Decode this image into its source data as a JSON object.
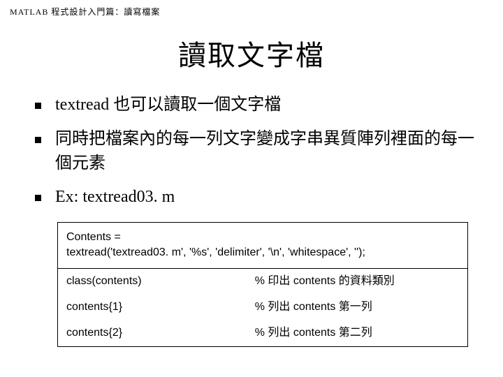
{
  "header": "MATLAB 程式設計入門篇：讀寫檔案",
  "title": "讀取文字檔",
  "bullets": [
    "textread 也可以讀取一個文字檔",
    "同時把檔案內的每一列文字變成字串異質陣列裡面的每一個元素",
    "Ex: textread03. m"
  ],
  "code": {
    "header_line1": "Contents =",
    "header_line2": "textread('textread03. m', '%s', 'delimiter', '\\n', 'whitespace', '');",
    "rows": [
      {
        "left": "class(contents)",
        "right": "% 印出 contents 的資料類別"
      },
      {
        "left": "contents{1}",
        "right": "% 列出 contents 第一列"
      },
      {
        "left": "contents{2}",
        "right": "% 列出 contents 第二列"
      }
    ]
  }
}
